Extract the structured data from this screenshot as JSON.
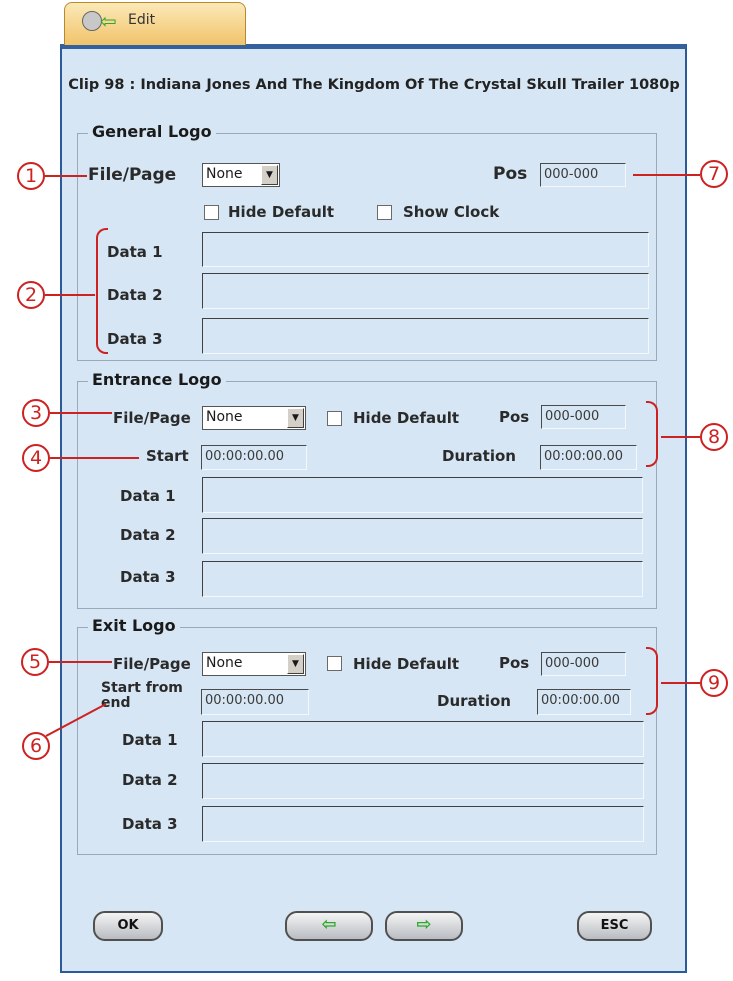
{
  "tab": {
    "label": "Edit",
    "icon": "film-reel-back-icon"
  },
  "title": "Clip 98 : Indiana Jones And The Kingdom Of The Crystal Skull Trailer 1080p",
  "general": {
    "legend": "General Logo",
    "file_label": "File/Page",
    "file_value": "None",
    "pos_label": "Pos",
    "pos_value": "000-000",
    "hide_default": "Hide Default",
    "show_clock": "Show Clock",
    "data1": "Data 1",
    "data2": "Data 2",
    "data3": "Data 3"
  },
  "entrance": {
    "legend": "Entrance Logo",
    "file_label": "File/Page",
    "file_value": "None",
    "hide_default": "Hide Default",
    "pos_label": "Pos",
    "pos_value": "000-000",
    "start_label": "Start",
    "start_value": "00:00:00.00",
    "duration_label": "Duration",
    "duration_value": "00:00:00.00",
    "data1": "Data 1",
    "data2": "Data 2",
    "data3": "Data 3"
  },
  "exit": {
    "legend": "Exit Logo",
    "file_label": "File/Page",
    "file_value": "None",
    "hide_default": "Hide Default",
    "pos_label": "Pos",
    "pos_value": "000-000",
    "start_label_1": "Start from",
    "start_label_2": "end",
    "start_value": "00:00:00.00",
    "duration_label": "Duration",
    "duration_value": "00:00:00.00",
    "data1": "Data 1",
    "data2": "Data 2",
    "data3": "Data 3"
  },
  "buttons": {
    "ok": "OK",
    "esc": "ESC",
    "prev_icon": "left-arrow-icon",
    "next_icon": "right-arrow-icon"
  },
  "callouts": [
    "1",
    "2",
    "3",
    "4",
    "5",
    "6",
    "7",
    "8",
    "9"
  ],
  "colors": {
    "panel": "#d6e6f4",
    "frame": "#2c5a98",
    "tab": "#f1c36a",
    "callout": "#cc2222",
    "arrow": "#2ea82a"
  }
}
